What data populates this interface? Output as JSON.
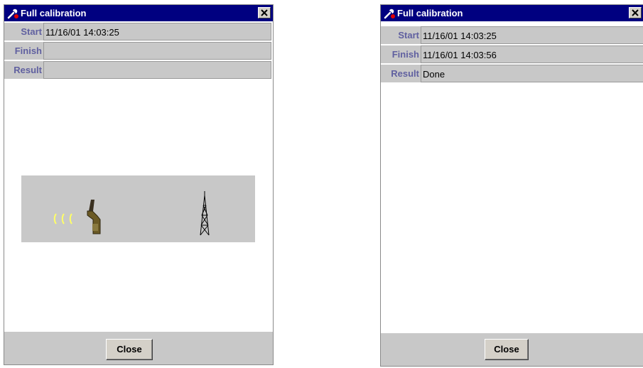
{
  "dialogs": [
    {
      "title": "Full calibration",
      "fields": {
        "start_label": "Start",
        "start_value": "11/16/01 14:03:25",
        "finish_label": "Finish",
        "finish_value": "",
        "result_label": "Result",
        "result_value": ""
      },
      "close_label": "Close",
      "state": "in-progress"
    },
    {
      "title": "Full calibration",
      "fields": {
        "start_label": "Start",
        "start_value": "11/16/01 14:03:25",
        "finish_label": "Finish",
        "finish_value": "11/16/01 14:03:56",
        "result_label": "Result",
        "result_value": "Done"
      },
      "close_label": "Close",
      "state": "done"
    }
  ],
  "icons": [
    "wrench-icon",
    "close-icon",
    "signal-waves-icon",
    "handset-icon",
    "antenna-tower-icon"
  ],
  "colors": {
    "titlebar": "#000080",
    "panel": "#c8c8c8",
    "label_text": "#6060a0",
    "signal": "#ffff66"
  }
}
